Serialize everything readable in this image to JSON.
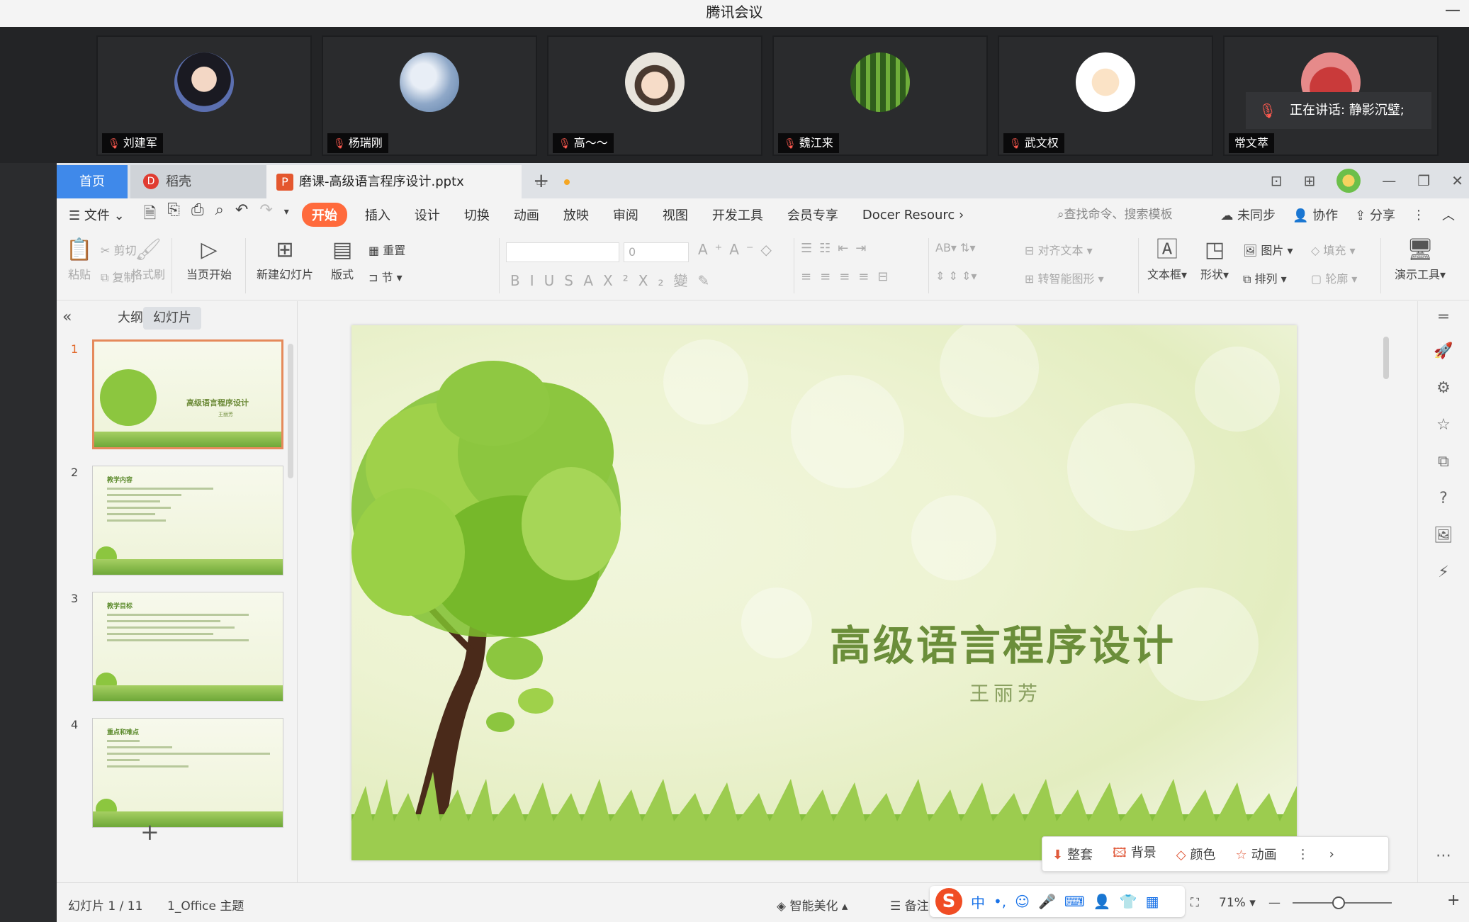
{
  "meeting": {
    "title": "腾讯会议",
    "minimize": "—",
    "participants": [
      {
        "name": "刘建军"
      },
      {
        "name": "杨瑞刚"
      },
      {
        "name": "高～～"
      },
      {
        "name": "魏江来"
      },
      {
        "name": "武文权"
      },
      {
        "name": "常文萃"
      }
    ],
    "speaking": "正在讲话: 静影沉璧;"
  },
  "wps": {
    "tabs": {
      "home": "首页",
      "daoke": "稻壳",
      "doc": "磨课-高级语言程序设计.pptx",
      "plus": "+"
    },
    "menu": {
      "file": "文件",
      "items": [
        "开始",
        "插入",
        "设计",
        "切换",
        "动画",
        "放映",
        "审阅",
        "视图",
        "开发工具",
        "会员专享",
        "Docer Resourc"
      ],
      "search": "查找命令、搜索模板",
      "right": [
        "未同步",
        "协作",
        "分享"
      ]
    },
    "ribbon": {
      "paste": "粘贴",
      "cut": "剪切",
      "copy": "复制",
      "format_painter": "格式刷",
      "from_current": "当页开始",
      "new_slide": "新建幻灯片",
      "layout": "版式",
      "reset": "重置",
      "section": "节",
      "font_size": "0",
      "align_text": "对齐文本",
      "to_smartart": "转智能图形",
      "textbox": "文本框",
      "shape": "形状",
      "picture": "图片",
      "arrange": "排列",
      "fill": "填充",
      "outline": "轮廓",
      "presenter_tools": "演示工具"
    },
    "sidebar": {
      "tabs": [
        "大纲",
        "幻灯片"
      ],
      "slides": [
        {
          "num": "1",
          "title": "高级语言程序设计",
          "sub": "王丽芳"
        },
        {
          "num": "2",
          "title": "教学内容"
        },
        {
          "num": "3",
          "title": "教学目标"
        },
        {
          "num": "4",
          "title": "重点和难点"
        }
      ],
      "add": "+"
    },
    "slide": {
      "title": "高级语言程序设计",
      "subtitle": "王丽芳"
    },
    "slide_toolbar": [
      "整套",
      "背景",
      "颜色",
      "动画"
    ],
    "status": {
      "slide_count": "幻灯片 1 / 11",
      "theme": "1_Office 主题",
      "beautify": "智能美化",
      "notes": "备注",
      "zoom": "71%",
      "ime": "中"
    }
  }
}
